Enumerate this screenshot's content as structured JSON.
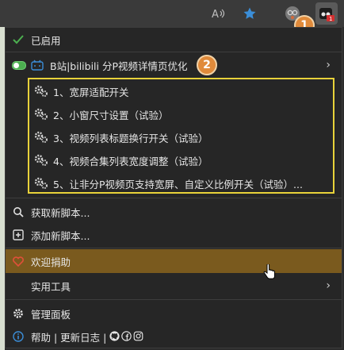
{
  "toolbar": {
    "read_aloud_icon": "read-aloud-icon",
    "favorite_icon": "star-icon",
    "profile_icon": "profile-icon",
    "extension_icon": "tampermonkey-icon",
    "callout_1": "1",
    "accent": "#3b8ed8"
  },
  "menu": {
    "enabled_label": "已启用",
    "script": {
      "name": "B站|bilibili 分P视频详情页优化",
      "callout_2": "2",
      "commands": [
        "1、宽屏适配开关",
        "2、小窗尺寸设置（试验）",
        "3、视频列表标题换行开关（试验）",
        "4、视频合集列表宽度调整（试验）",
        "5、让非分P视频页支持宽屏、自定义比例开关（试验）..."
      ]
    },
    "get_new_scripts": "获取新脚本...",
    "add_new_script": "添加新脚本...",
    "donate": "欢迎捐助",
    "utilities": "实用工具",
    "dashboard": "管理面板",
    "help_updates": "帮助 | 更新日志 |",
    "highlight_color": "#7a5a1e",
    "box_color": "#e8d23a"
  }
}
